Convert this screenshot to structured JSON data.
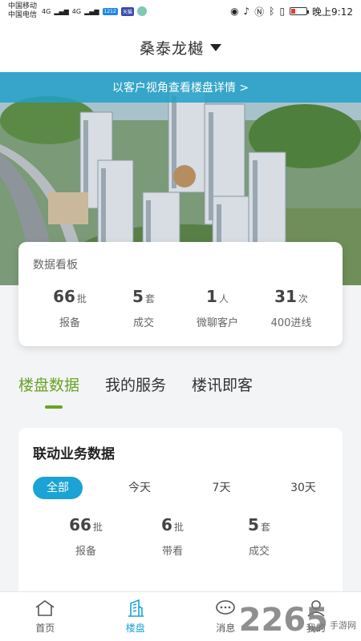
{
  "status_bar": {
    "carrier1": "中国移动",
    "carrier2": "中国电信",
    "net1": "4G",
    "net2": "4G",
    "chip1": "1212",
    "chip2": "天猫",
    "time": "晚上9:12",
    "icons": [
      "eye-icon",
      "mute-icon",
      "nfc-icon",
      "bluetooth-icon",
      "vibrate-icon",
      "battery-icon"
    ]
  },
  "header": {
    "title": "桑泰龙樾"
  },
  "banner": {
    "text": "以客户视角查看楼盘详情 >"
  },
  "dashboard": {
    "title": "数据看板",
    "stats": [
      {
        "value": "66",
        "unit": "批",
        "label": "报备"
      },
      {
        "value": "5",
        "unit": "套",
        "label": "成交"
      },
      {
        "value": "1",
        "unit": "人",
        "label": "微聊客户"
      },
      {
        "value": "31",
        "unit": "次",
        "label": "400进线"
      }
    ]
  },
  "tabs": [
    {
      "label": "楼盘数据",
      "active": true
    },
    {
      "label": "我的服务",
      "active": false
    },
    {
      "label": "楼讯即客",
      "active": false
    }
  ],
  "linkage": {
    "title": "联动业务数据",
    "filters": [
      {
        "label": "全部",
        "active": true
      },
      {
        "label": "今天",
        "active": false
      },
      {
        "label": "7天",
        "active": false
      },
      {
        "label": "30天",
        "active": false
      }
    ],
    "stats": [
      {
        "value": "66",
        "unit": "批",
        "label": "报备"
      },
      {
        "value": "6",
        "unit": "批",
        "label": "带看"
      },
      {
        "value": "5",
        "unit": "套",
        "label": "成交"
      }
    ]
  },
  "bottom_nav": [
    {
      "label": "首页",
      "icon": "home-icon",
      "active": false
    },
    {
      "label": "楼盘",
      "icon": "building-icon",
      "active": true
    },
    {
      "label": "消息",
      "icon": "message-icon",
      "active": false
    },
    {
      "label": "我的",
      "icon": "user-icon",
      "active": false
    }
  ],
  "watermark": {
    "big": "2265",
    "small": "手游网"
  },
  "colors": {
    "accent_blue": "#1aa3d4",
    "accent_green": "#6aa224",
    "banner": "#22a0c8"
  }
}
